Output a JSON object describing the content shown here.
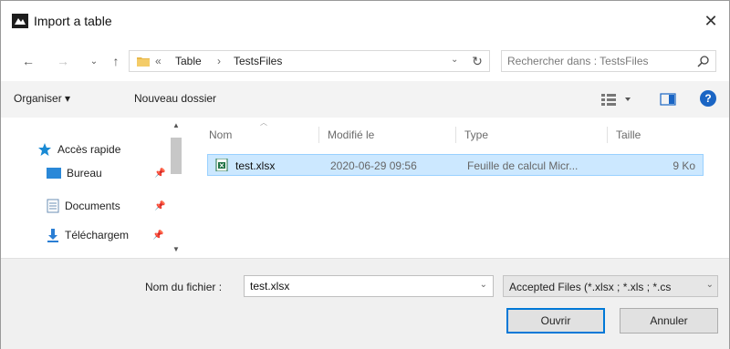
{
  "window": {
    "title": "Import a table",
    "close_glyph": "✕"
  },
  "nav": {
    "back_glyph": "←",
    "forward_glyph": "→",
    "recent_glyph": "⌄",
    "up_glyph": "↑"
  },
  "address": {
    "separator": "«",
    "breadcrumbs": [
      "Table",
      "TestsFiles"
    ],
    "crumb_separator": "›",
    "dropdown_glyph": "⌄",
    "refresh_glyph": "↻"
  },
  "search": {
    "placeholder": "Rechercher dans : TestsFiles"
  },
  "toolbar": {
    "organise_label": "Organiser ▾",
    "new_folder_label": "Nouveau dossier",
    "help_glyph": "?"
  },
  "sidebar": {
    "quick_access": "Accès rapide",
    "items": [
      {
        "label": "Bureau"
      },
      {
        "label": "Documents"
      },
      {
        "label": "Téléchargem"
      }
    ],
    "pin_glyph": "📌"
  },
  "columns": {
    "name": "Nom",
    "modified": "Modifié le",
    "type": "Type",
    "size": "Taille"
  },
  "files": [
    {
      "name": "test.xlsx",
      "modified": "2020-06-29 09:56",
      "type": "Feuille de calcul Micr...",
      "size": "9 Ko"
    }
  ],
  "bottom": {
    "filename_label": "Nom du fichier :",
    "filename_value": "test.xlsx",
    "filter_label": "Accepted Files (*.xlsx ; *.xls ; *.cs",
    "open_label": "Ouvrir",
    "cancel_label": "Annuler"
  },
  "colors": {
    "accent": "#0078d7",
    "selection": "#cce8ff",
    "excel_green": "#1f7244",
    "folder_yellow": "#e8b84a",
    "help_blue": "#1a65c4"
  }
}
